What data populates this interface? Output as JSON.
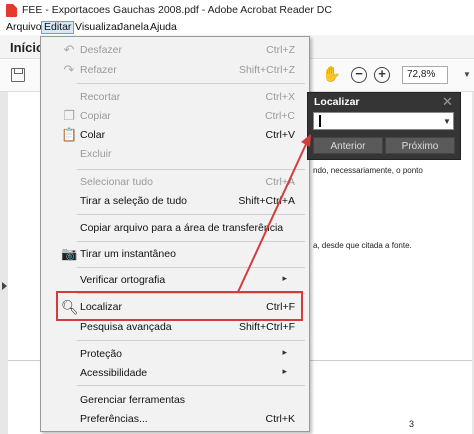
{
  "window": {
    "title": "FEE - Exportacoes Gauchas 2008.pdf - Adobe Acrobat Reader DC"
  },
  "menubar": {
    "items": [
      {
        "label": "Arquivo"
      },
      {
        "label": "Editar"
      },
      {
        "label": "Visualizar"
      },
      {
        "label": "Janela"
      },
      {
        "label": "Ajuda"
      }
    ]
  },
  "tabs": {
    "home": "Início"
  },
  "toolbar": {
    "zoom_value": "72,8%"
  },
  "edit_menu": {
    "items": [
      {
        "label": "Desfazer",
        "shortcut": "Ctrl+Z",
        "icon": "undo-icon"
      },
      {
        "label": "Refazer",
        "shortcut": "Shift+Ctrl+Z",
        "icon": "redo-icon"
      },
      {
        "label": "Recortar",
        "shortcut": "Ctrl+X",
        "icon": "cut-icon"
      },
      {
        "label": "Copiar",
        "shortcut": "Ctrl+C",
        "icon": "copy-icon"
      },
      {
        "label": "Colar",
        "shortcut": "Ctrl+V",
        "icon": "paste-icon"
      },
      {
        "label": "Excluir",
        "shortcut": ""
      },
      {
        "label": "Selecionar tudo",
        "shortcut": "Ctrl+A"
      },
      {
        "label": "Tirar a seleção de tudo",
        "shortcut": "Shift+Ctrl+A"
      },
      {
        "label": "Copiar arquivo para a área de transferência",
        "shortcut": ""
      },
      {
        "label": "Tirar um instantâneo",
        "shortcut": "",
        "icon": "camera-icon"
      },
      {
        "label": "Verificar ortografia",
        "shortcut": ""
      },
      {
        "label": "Localizar",
        "shortcut": "Ctrl+F",
        "icon": "search-icon"
      },
      {
        "label": "Pesquisa avançada",
        "shortcut": "Shift+Ctrl+F"
      },
      {
        "label": "Proteção",
        "shortcut": ""
      },
      {
        "label": "Acessibilidade",
        "shortcut": ""
      },
      {
        "label": "Gerenciar ferramentas",
        "shortcut": ""
      },
      {
        "label": "Preferências...",
        "shortcut": "Ctrl+K"
      }
    ]
  },
  "find_dialog": {
    "title": "Localizar",
    "input_value": "",
    "prev_label": "Anterior",
    "next_label": "Próximo"
  },
  "document": {
    "lines": [
      "ndo, necessariamente, o ponto",
      "a, desde que citada a fonte."
    ],
    "page_number": "3"
  },
  "colors": {
    "highlight_border": "#d33c3c",
    "arrow": "#d33c3c",
    "find_panel_bg": "#353535",
    "menu_bg": "#f2f2f2"
  }
}
